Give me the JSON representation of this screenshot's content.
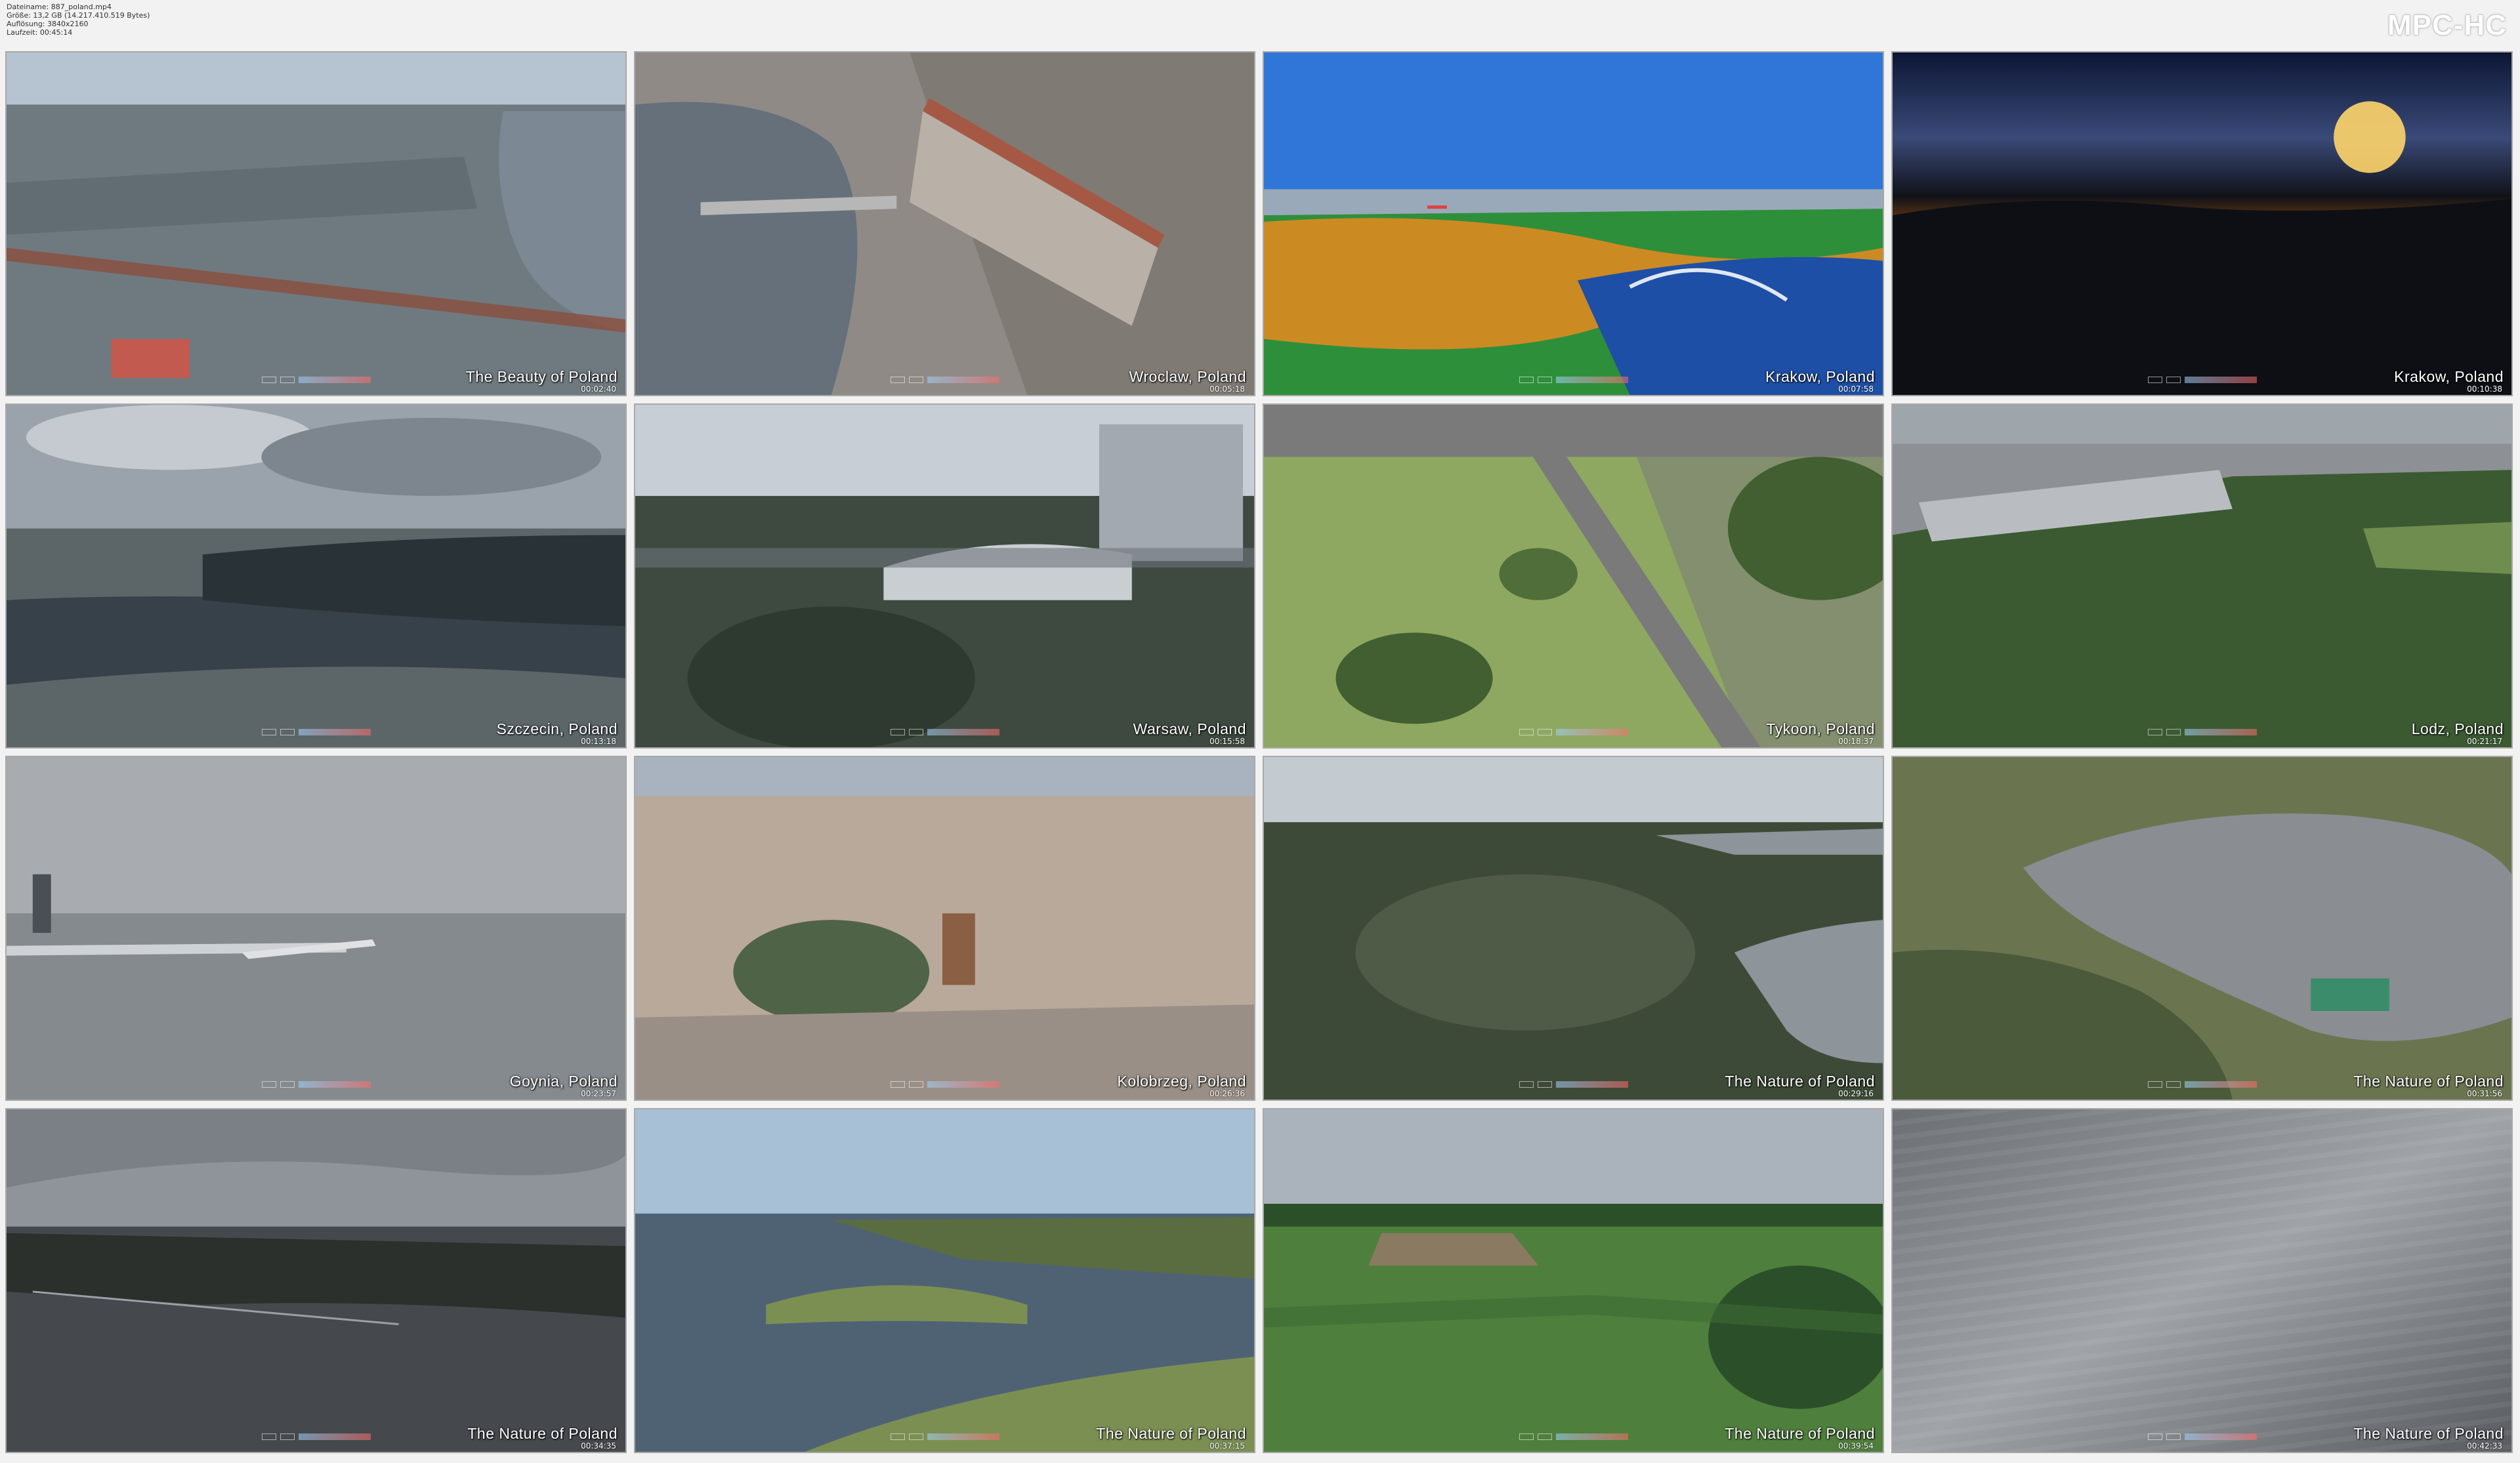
{
  "file_info": {
    "filename": "Dateiname: 887_poland.mp4",
    "size": "Größe: 13,2 GB (14.217.410.519 Bytes)",
    "resolution": "Auflösung: 3840x2160",
    "duration": "Laufzeit: 00:45:14"
  },
  "brand": "MPC-HC",
  "thumbnails": [
    {
      "caption": "The Beauty of Poland",
      "timestamp": "00:02:40",
      "scene": "city-river",
      "colors": [
        "#b6c3d1",
        "#7c8893",
        "#6f7a80",
        "#5d676d"
      ]
    },
    {
      "caption": "Wroclaw, Poland",
      "timestamp": "00:05:18",
      "scene": "old-town",
      "colors": [
        "#8f8a86",
        "#65707a",
        "#b9b1a7",
        "#a55945"
      ]
    },
    {
      "caption": "Krakow, Poland",
      "timestamp": "00:07:58",
      "scene": "park-bridge",
      "colors": [
        "#2f76d8",
        "#cc8a23",
        "#2e8f3b",
        "#1e4fa6"
      ]
    },
    {
      "caption": "Krakow, Poland",
      "timestamp": "00:10:38",
      "scene": "sunset",
      "colors": [
        "#0f1830",
        "#d68519",
        "#101218",
        "#ffd56a"
      ]
    },
    {
      "caption": "Szczecin, Poland",
      "timestamp": "00:13:18",
      "scene": "harbor-cloudy",
      "colors": [
        "#9aa3ab",
        "#37414a",
        "#5c6668",
        "#293236"
      ]
    },
    {
      "caption": "Warsaw, Poland",
      "timestamp": "00:15:58",
      "scene": "stadium",
      "colors": [
        "#c7ced6",
        "#3e4a3f",
        "#a3a9b0",
        "#2e3a2f"
      ]
    },
    {
      "caption": "Tykoon, Poland",
      "timestamp": "00:18:37",
      "scene": "road-fields",
      "colors": [
        "#6f8e4a",
        "#8ea861",
        "#7a7a7a",
        "#415f30"
      ]
    },
    {
      "caption": "Lodz, Poland",
      "timestamp": "00:21:17",
      "scene": "forest-city",
      "colors": [
        "#9fa6ab",
        "#3b5a32",
        "#8d9094",
        "#2f4a29"
      ]
    },
    {
      "caption": "Goynia, Poland",
      "timestamp": "00:23:57",
      "scene": "sea-port",
      "colors": [
        "#a8abaf",
        "#5b6066",
        "#858a8f",
        "#4a4f55"
      ]
    },
    {
      "caption": "Kolobrzeg, Poland",
      "timestamp": "00:26:36",
      "scene": "coastal-town",
      "colors": [
        "#a8b3bf",
        "#7c8489",
        "#b9a99a",
        "#4f6446"
      ]
    },
    {
      "caption": "The Nature of Poland",
      "timestamp": "00:29:16",
      "scene": "lake-marsh",
      "colors": [
        "#c3cad0",
        "#3d4a37",
        "#8d949a",
        "#57624e"
      ]
    },
    {
      "caption": "The Nature of Poland",
      "timestamp": "00:31:56",
      "scene": "peninsula",
      "colors": [
        "#7f858a",
        "#6a7550",
        "#8a8e93",
        "#4b5a3a"
      ]
    },
    {
      "caption": "The Nature of Poland",
      "timestamp": "00:34:35",
      "scene": "dark-landscape",
      "colors": [
        "#7b8086",
        "#2b302c",
        "#45494d",
        "#1f2320"
      ]
    },
    {
      "caption": "The Nature of Poland",
      "timestamp": "00:37:15",
      "scene": "lake-reeds",
      "colors": [
        "#a8c0d6",
        "#4f6274",
        "#7b8f53",
        "#5a6d41"
      ]
    },
    {
      "caption": "The Nature of Poland",
      "timestamp": "00:39:54",
      "scene": "green-fields",
      "colors": [
        "#aab3bc",
        "#3c6a33",
        "#4f7f3d",
        "#2b4f28"
      ]
    },
    {
      "caption": "The Nature of Poland",
      "timestamp": "00:42:33",
      "scene": "motion-blur",
      "colors": [
        "#8e9297",
        "#6b6f74",
        "#a0a4a8",
        "#585c61"
      ]
    }
  ]
}
